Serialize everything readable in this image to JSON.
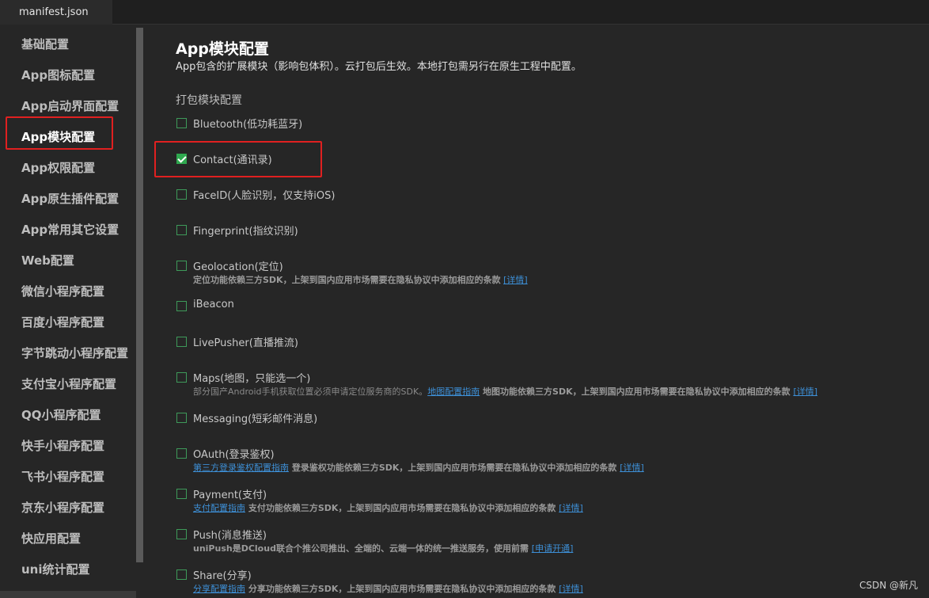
{
  "tab": {
    "label": "manifest.json"
  },
  "sidebar": {
    "items": [
      {
        "label": "基础配置"
      },
      {
        "label": "App图标配置"
      },
      {
        "label": "App启动界面配置"
      },
      {
        "label": "App模块配置",
        "active": true
      },
      {
        "label": "App权限配置"
      },
      {
        "label": "App原生插件配置"
      },
      {
        "label": "App常用其它设置"
      },
      {
        "label": "Web配置"
      },
      {
        "label": "微信小程序配置"
      },
      {
        "label": "百度小程序配置"
      },
      {
        "label": "字节跳动小程序配置"
      },
      {
        "label": "支付宝小程序配置"
      },
      {
        "label": "QQ小程序配置"
      },
      {
        "label": "快手小程序配置"
      },
      {
        "label": "飞书小程序配置"
      },
      {
        "label": "京东小程序配置"
      },
      {
        "label": "快应用配置"
      },
      {
        "label": "uni统计配置"
      }
    ]
  },
  "main": {
    "title": "App模块配置",
    "description": "App包含的扩展模块（影响包体积）。云打包后生效。本地打包需另行在原生工程中配置。",
    "section_title": "打包模块配置",
    "options": [
      {
        "label": "Bluetooth(低功耗蓝牙)",
        "checked": false
      },
      {
        "label": "Contact(通讯录)",
        "checked": true
      },
      {
        "label": "FaceID(人脸识别，仅支持iOS)",
        "checked": false
      },
      {
        "label": "Fingerprint(指纹识别)",
        "checked": false
      },
      {
        "label": "Geolocation(定位)",
        "checked": false,
        "note_bold": "定位功能依赖三方SDK，上架到国内应用市场需要在隐私协议中添加相应的条款",
        "note_link": "[详情]"
      },
      {
        "label": "iBeacon",
        "checked": false
      },
      {
        "label": "LivePusher(直播推流)",
        "checked": false
      },
      {
        "label": "Maps(地图，只能选一个)",
        "checked": false,
        "note_text": "部分国产Android手机获取位置必须申请定位服务商的SDK。",
        "note_link1": "地图配置指南",
        "note_bold": " 地图功能依赖三方SDK，上架到国内应用市场需要在隐私协议中添加相应的条款 ",
        "note_link": "[详情]"
      },
      {
        "label": "Messaging(短彩邮件消息)",
        "checked": false
      },
      {
        "label": "OAuth(登录鉴权)",
        "checked": false,
        "note_link1": "第三方登录鉴权配置指南",
        "note_bold": " 登录鉴权功能依赖三方SDK，上架到国内应用市场需要在隐私协议中添加相应的条款 ",
        "note_link": "[详情]"
      },
      {
        "label": "Payment(支付)",
        "checked": false,
        "note_link1": "支付配置指南",
        "note_bold": " 支付功能依赖三方SDK，上架到国内应用市场需要在隐私协议中添加相应的条款 ",
        "note_link": "[详情]"
      },
      {
        "label": "Push(消息推送)",
        "checked": false,
        "note_bold": "uniPush是DCloud联合个推公司推出、全端的、云端一体的统一推送服务，使用前需 ",
        "note_link": "[申请开通]"
      },
      {
        "label": "Share(分享)",
        "checked": false,
        "note_link1": "分享配置指南",
        "note_bold": " 分享功能依赖三方SDK，上架到国内应用市场需要在隐私协议中添加相应的条款 ",
        "note_link": "[详情]"
      }
    ]
  },
  "watermark": "CSDN @新凡"
}
